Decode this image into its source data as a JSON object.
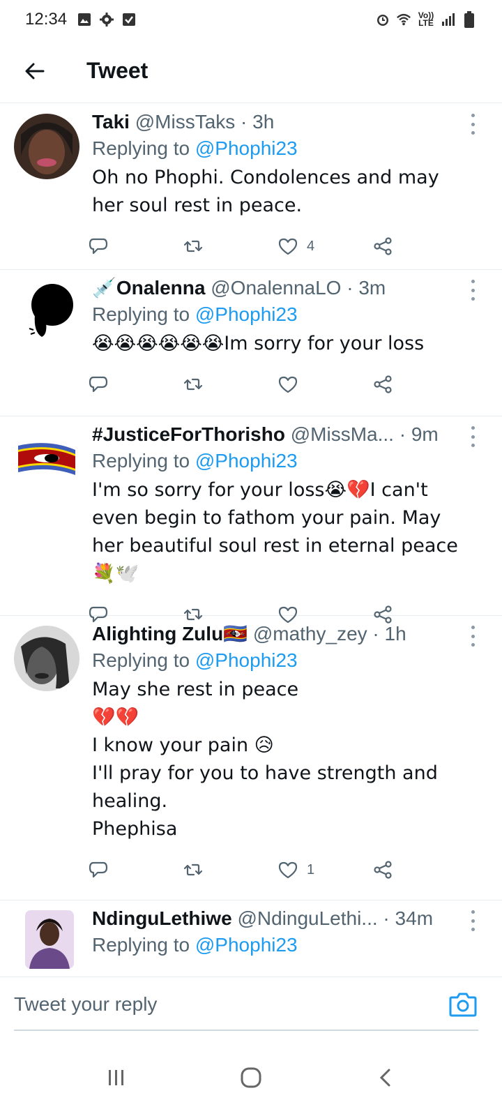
{
  "status_bar": {
    "time": "12:34",
    "network": "Vo)) LTE",
    "left_icons": [
      "image-icon",
      "gear-icon",
      "check-square-icon"
    ],
    "right_icons": [
      "alarm-icon",
      "wifi-icon",
      "signal-icon",
      "battery-icon"
    ]
  },
  "header": {
    "title": "Tweet",
    "back_icon": "arrow-left-icon"
  },
  "replying_prefix": "Replying to",
  "tweets": [
    {
      "name": "Taki",
      "handle": "@MissTaks",
      "time": "3h",
      "reply_to": "@Phophi23",
      "text": "Oh no Phophi. Condolences and may her soul rest in peace.",
      "likes": "4",
      "avatar_color": "#5a3b2e"
    },
    {
      "name": "Onalenna",
      "name_prefix_emoji": "💉",
      "handle": "@OnalennaLO",
      "time": "3m",
      "reply_to": "@Phophi23",
      "text": "😭😭😭😭😭😭Im sorry for your loss",
      "likes": "",
      "avatar_color": "#ffffff"
    },
    {
      "name": "#JusticeForThorisho",
      "handle": "@MissMa...",
      "time": "9m",
      "reply_to": "@Phophi23",
      "text": "I'm so sorry for your loss😭💔I can't even begin to fathom your pain. May her beautiful soul rest in eternal peace💐🕊️",
      "likes": "",
      "avatar_color": "#3e5eb9"
    },
    {
      "name": "Alighting Zulu",
      "name_suffix_emoji": "🇸🇿",
      "handle": "@mathy_zey",
      "time": "1h",
      "reply_to": "@Phophi23",
      "text": "May she rest in peace\n💔💔\nI know your pain 😥\nI'll pray for you to have strength and healing.\nPhephisa",
      "likes": "1",
      "avatar_color": "#777777"
    },
    {
      "name": "NdinguLethiwe",
      "handle": "@NdinguLethi...",
      "time": "34m",
      "reply_to": "@Phophi23",
      "text": "",
      "likes": "",
      "avatar_color": "#6b4a8a"
    }
  ],
  "reply_bar": {
    "placeholder": "Tweet your reply",
    "camera_icon": "camera-icon"
  },
  "nav_bar": {
    "icons": [
      "recent-apps-icon",
      "home-icon",
      "back-icon"
    ]
  },
  "colors": {
    "accent": "#1d9bf0",
    "text": "#0f1419",
    "secondary": "#536471",
    "divider": "#e6ecf0"
  }
}
